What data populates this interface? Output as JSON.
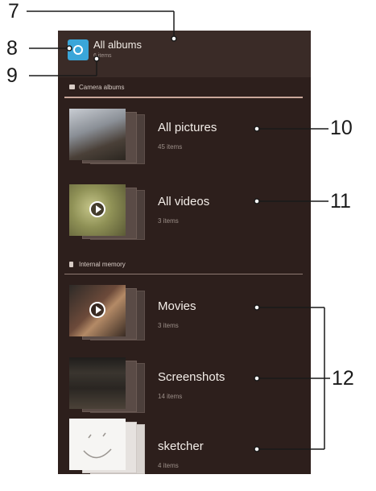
{
  "header": {
    "title": "All albums",
    "subtitle": "6 items"
  },
  "sections": {
    "camera": {
      "label": "Camera albums"
    },
    "internal": {
      "label": "Internal memory"
    }
  },
  "albums": [
    {
      "name": "All pictures",
      "count": "45 items"
    },
    {
      "name": "All videos",
      "count": "3 items"
    },
    {
      "name": "Movies",
      "count": "3 items"
    },
    {
      "name": "Screenshots",
      "count": "14 items"
    },
    {
      "name": "sketcher",
      "count": "4 items"
    }
  ],
  "callouts": [
    "7",
    "8",
    "9",
    "10",
    "11",
    "12"
  ],
  "icons": {
    "app": "gallery-app-icon",
    "camera": "camera-icon",
    "memory": "memory-card-icon",
    "play": "play-icon"
  },
  "colors": {
    "background": "#2d1f1c",
    "accent": "#3aa6d9",
    "divider": "#c9a79a"
  }
}
